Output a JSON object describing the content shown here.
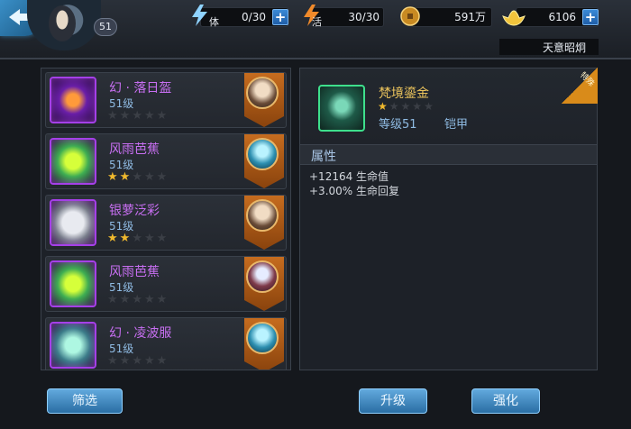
{
  "player": {
    "level": "51"
  },
  "resources": {
    "stamina": {
      "label": "体",
      "value": "0/30"
    },
    "vitality": {
      "label": "活",
      "value": "30/30"
    },
    "coins": {
      "value": "591万"
    },
    "ingots": {
      "value": "6106"
    }
  },
  "player_title": "天意昭炯",
  "items": [
    {
      "name": "幻 · 落日盔",
      "level": "51级",
      "stars_filled": 0,
      "stars_total": 5,
      "icon": "helmet-icon"
    },
    {
      "name": "风雨芭蕉",
      "level": "51级",
      "stars_filled": 2,
      "stars_total": 5,
      "icon": "fan-icon"
    },
    {
      "name": "银萝泛彩",
      "level": "51级",
      "stars_filled": 2,
      "stars_total": 5,
      "icon": "silver-armor-icon"
    },
    {
      "name": "风雨芭蕉",
      "level": "51级",
      "stars_filled": 0,
      "stars_total": 5,
      "icon": "fan-icon"
    },
    {
      "name": "幻 · 凌波服",
      "level": "51级",
      "stars_filled": 0,
      "stars_total": 5,
      "icon": "robe-icon"
    }
  ],
  "detail": {
    "corner_label": "特殊",
    "name": "梵境鎏金",
    "stars_filled": 1,
    "stars_total": 5,
    "level": "等级51",
    "type": "铠甲",
    "attr_title": "属性",
    "attrs": [
      "+12164 生命值",
      "+3.00% 生命回复"
    ]
  },
  "buttons": {
    "filter": "筛选",
    "upgrade": "升级",
    "enhance": "强化"
  },
  "colors": {
    "purple_quality": "#a540e8",
    "green_quality": "#3ee08c",
    "star_gold": "#f0b92d",
    "button_blue": "#2a6ea4"
  }
}
